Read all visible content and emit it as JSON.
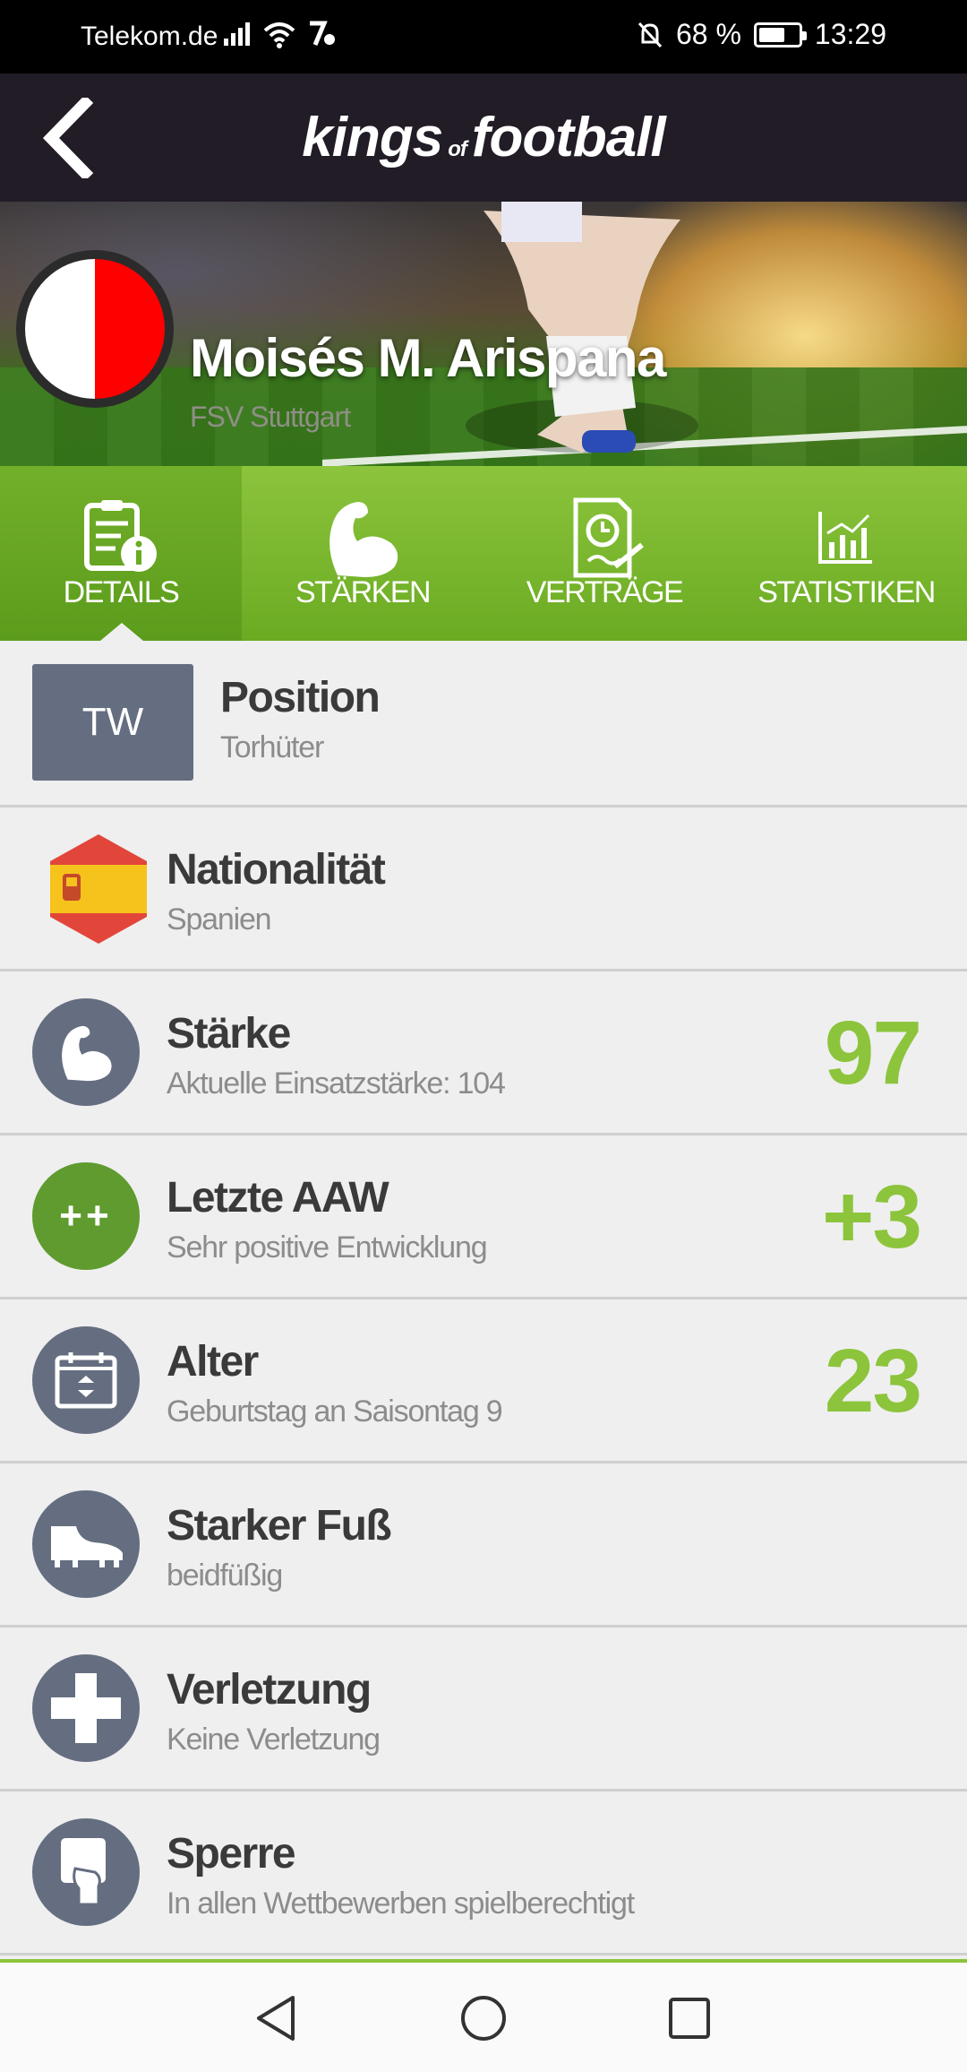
{
  "status_bar": {
    "carrier": "Telekom.de",
    "battery_percent": "68 %",
    "battery_level": 0.68,
    "time": "13:29"
  },
  "header": {
    "logo_part1": "kings",
    "logo_part2": "of",
    "logo_part3": "football"
  },
  "player": {
    "name": "Moisés M. Arispana",
    "club": "FSV Stuttgart",
    "club_colors": [
      "#ffffff",
      "#ff0000"
    ]
  },
  "tabs": [
    {
      "label": "DETAILS",
      "icon": "details-icon",
      "active": true
    },
    {
      "label": "STÄRKEN",
      "icon": "muscle-icon",
      "active": false
    },
    {
      "label": "VERTRÄGE",
      "icon": "contract-icon",
      "active": false
    },
    {
      "label": "STATISTIKEN",
      "icon": "chart-icon",
      "active": false
    }
  ],
  "details": {
    "position": {
      "badge": "TW",
      "title": "Position",
      "subtitle": "Torhüter"
    },
    "nationality": {
      "title": "Nationalität",
      "subtitle": "Spanien",
      "icon": "spain-flag-icon"
    },
    "strength": {
      "title": "Stärke",
      "subtitle": "Aktuelle Einsatzstärke: 104",
      "value": "97",
      "icon": "muscle-icon"
    },
    "last_aaw": {
      "title": "Letzte AAW",
      "subtitle": "Sehr positive Entwicklung",
      "value": "+3",
      "icon_text": "++"
    },
    "age": {
      "title": "Alter",
      "subtitle": "Geburtstag an Saisontag 9",
      "value": "23",
      "icon": "calendar-icon"
    },
    "strong_foot": {
      "title": "Starker Fuß",
      "subtitle": "beidfüßig",
      "icon": "boot-icon"
    },
    "injury": {
      "title": "Verletzung",
      "subtitle": "Keine Verletzung",
      "icon": "cross-icon"
    },
    "suspension": {
      "title": "Sperre",
      "subtitle": "In allen Wettbewerben spielberechtigt",
      "icon": "card-icon"
    }
  },
  "colors": {
    "accent_green": "#8cc43c",
    "header_bg": "#221c27",
    "icon_slate": "#656e80"
  }
}
